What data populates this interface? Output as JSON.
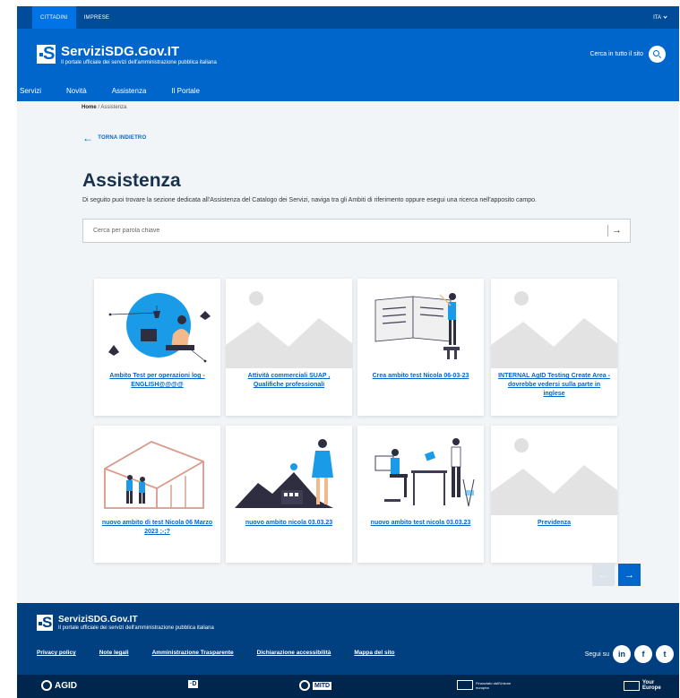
{
  "topbar": {
    "tab_citizens": "CITTADINI",
    "tab_business": "IMPRESE",
    "language": "ITA"
  },
  "header": {
    "site_name": "ServiziSDG.Gov.IT",
    "tagline": "Il portale ufficiale dei servizi dell'amministrazione pubblica italiana",
    "search_label": "Cerca in tutto il sito",
    "logo_letter": "S"
  },
  "nav": {
    "items": [
      "Servizi",
      "Novità",
      "Assistenza",
      "Il Portale"
    ]
  },
  "breadcrumb": {
    "home": "Home",
    "separator": " / ",
    "current": "Assistenza"
  },
  "back_label": "TORNA INDIETRO",
  "page": {
    "title": "Assistenza",
    "description": "Di seguito puoi trovare la sezione dedicata all'Assistenza del Catalogo dei Servizi, naviga tra gli Ambiti di riferimento oppure esegui una ricerca nell'apposito campo."
  },
  "search": {
    "placeholder": "Cerca per parola chiave"
  },
  "cards": [
    {
      "label": "Ambito Test per operazioni log - ENGLISH@@@@",
      "image": "reading-person-illustration"
    },
    {
      "label": "Attività commerciali SUAP , Qualifiche professionali",
      "image": "placeholder-mountain-image"
    },
    {
      "label": "Crea ambito test Nicola 06-03-23",
      "image": "book-person-illustration"
    },
    {
      "label": "INTERNAL AgID Testing Create Area - dovrebbe vedersi sulla parte in inglese",
      "image": "placeholder-mountain-image"
    },
    {
      "label": "nuovo ambito di test Nicola 06 Marzo 2023 ;-;?",
      "image": "house-frame-illustration"
    },
    {
      "label": "nuovo ambito nicola 03.03.23",
      "image": "woman-landscape-illustration"
    },
    {
      "label": "nuovo ambito test nicola 03.03.23",
      "image": "desk-workers-illustration"
    },
    {
      "label": "Previdenza",
      "image": "placeholder-mountain-image"
    }
  ],
  "pager": {
    "prev": "←",
    "next": "→"
  },
  "footer": {
    "site_name": "ServiziSDG.Gov.IT",
    "tagline": "Il portale ufficiale dei servizi dell'amministrazione pubblica italiana",
    "links": [
      "Privacy policy",
      "Note legali",
      "Amministrazione Trasparente",
      "Dichiarazione accessibilità",
      "Mappa del sito"
    ],
    "follow_label": "Segui su",
    "social": [
      "in",
      "f",
      "t"
    ],
    "partners": {
      "agid": "AGID",
      "dtd": "·D",
      "mitd": "MITD",
      "eu_text": "Finanziato dall'Unione europea",
      "your_europe": "Your Europe"
    }
  },
  "colors": {
    "primary": "#0066cc",
    "topbar": "#004c99",
    "footer": "#004080",
    "partners_bar": "#00264d",
    "title": "#17324d"
  }
}
